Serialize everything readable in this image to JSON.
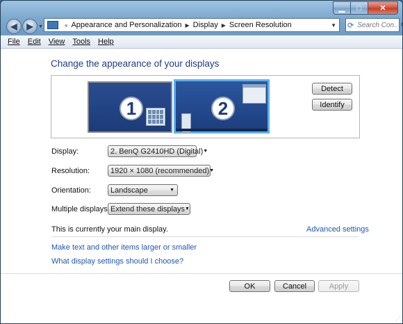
{
  "window": {
    "minimize_icon": "minimize-icon",
    "maximize_icon": "maximize-icon",
    "close_icon": "close-icon"
  },
  "nav": {
    "back_icon": "back-arrow-icon",
    "forward_icon": "forward-arrow-icon",
    "breadcrumbs": [
      "Appearance and Personalization",
      "Display",
      "Screen Resolution"
    ],
    "search_placeholder": "Search Con..."
  },
  "menu": [
    {
      "label": "File"
    },
    {
      "label": "Edit"
    },
    {
      "label": "View"
    },
    {
      "label": "Tools"
    },
    {
      "label": "Help"
    }
  ],
  "main": {
    "heading": "Change the appearance of your displays",
    "monitors": [
      {
        "number": "1",
        "selected": false
      },
      {
        "number": "2",
        "selected": true
      }
    ],
    "detect_label": "Detect",
    "identify_label": "Identify",
    "display_label": "Display:",
    "display_value": "2. BenQ G2410HD (Digital)",
    "resolution_label": "Resolution:",
    "resolution_value": "1920 × 1080 (recommended)",
    "orientation_label": "Orientation:",
    "orientation_value": "Landscape",
    "multiple_label": "Multiple displays:",
    "multiple_value": "Extend these displays",
    "main_note": "This is currently your main display.",
    "advanced_link": "Advanced settings",
    "link_text_size": "Make text and other items larger or smaller",
    "link_which_settings": "What display settings should I choose?"
  },
  "footer": {
    "ok_label": "OK",
    "cancel_label": "Cancel",
    "apply_label": "Apply"
  },
  "colors": {
    "heading": "#1e3c8c",
    "link": "#1f56b4",
    "monitor_selected_border": "#5ab0ee"
  }
}
